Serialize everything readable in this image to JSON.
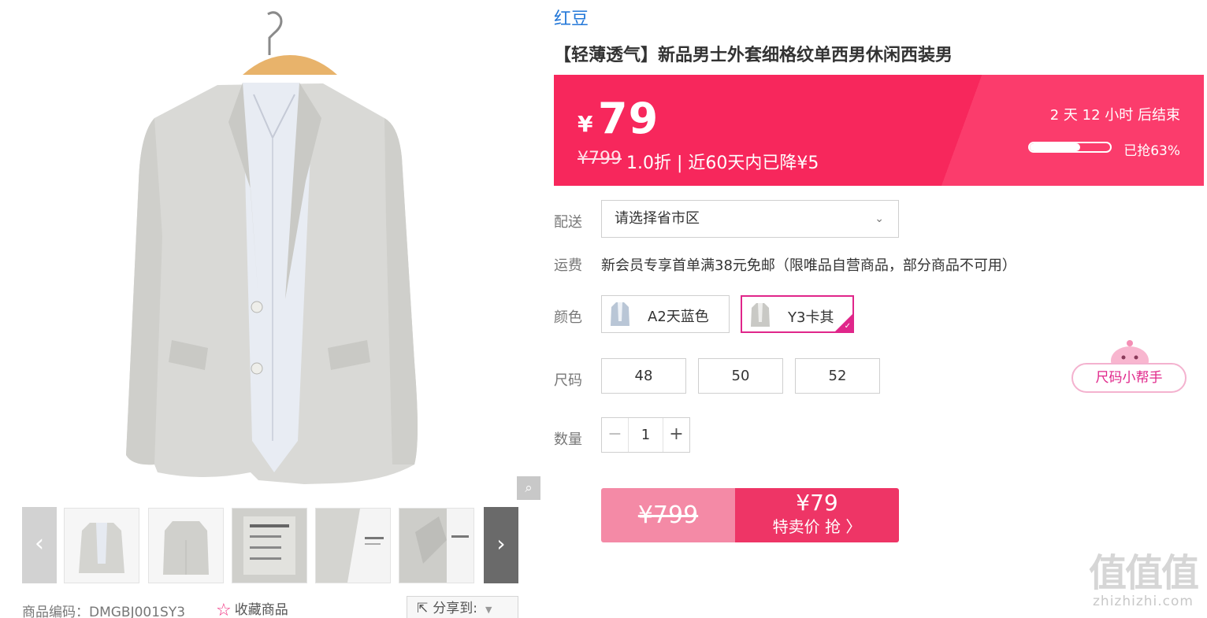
{
  "gallery": {
    "zoom_icon": "magnifier-icon",
    "prev_icon": "chevron-left-icon",
    "next_icon": "chevron-right-icon",
    "thumbnail_count": 6
  },
  "meta": {
    "sku_code": "商品编码：DMGBJ001SY3",
    "favorite_label": "收藏商品",
    "share_label": "分享到:"
  },
  "product": {
    "brand": "红豆",
    "title": "【轻薄透气】新品男士外套细格纹单西男休闲西装男"
  },
  "price": {
    "currency_symbol": "¥",
    "current": "79",
    "original": "¥799",
    "discount_info": "1.0折 | 近60天内已降¥5",
    "countdown": "2  天  12  小时  后结束",
    "sold_percent": 0.63,
    "sold_label": "已抢63%"
  },
  "delivery": {
    "label": "配送",
    "select_value": "请选择省市区"
  },
  "shipping": {
    "label": "运费",
    "text": "新会员专享首单满38元免邮（限唯品自营商品，部分商品不可用）"
  },
  "color": {
    "label": "颜色",
    "options": [
      {
        "label": "A2天蓝色",
        "selected": false
      },
      {
        "label": "Y3卡其",
        "selected": true
      }
    ]
  },
  "size": {
    "label": "尺码",
    "options": [
      "48",
      "50",
      "52"
    ],
    "helper_label": "尺码小帮手"
  },
  "quantity": {
    "label": "数量",
    "value": "1",
    "minus": "−",
    "plus": "+"
  },
  "buy_button": {
    "original_price": "¥799",
    "special_price": "¥79",
    "action_label": "特卖价 抢 〉"
  },
  "watermark": {
    "logo_text": "值值值",
    "site": "zhizhizhi.com"
  },
  "colors": {
    "accent": "#f7275c",
    "brand_link": "#2277d8",
    "selected_border": "#e0268a",
    "buy_left": "#f48aa6",
    "buy_right": "#ee3566"
  }
}
